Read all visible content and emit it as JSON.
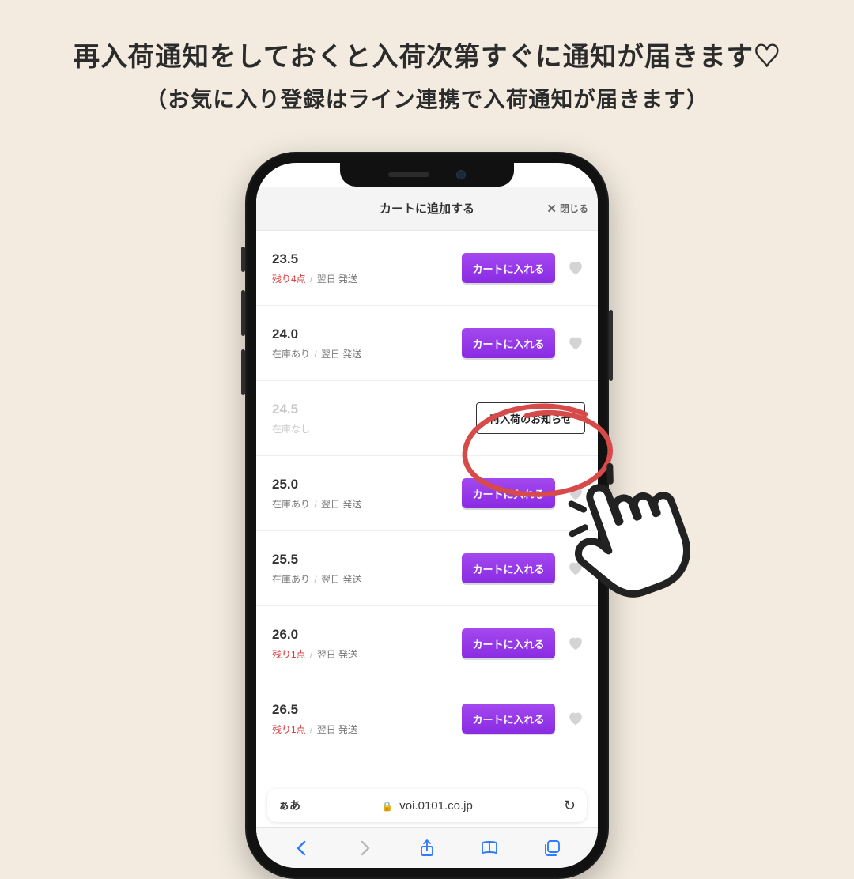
{
  "heading": {
    "line1": "再入荷通知をしておくと入荷次第すぐに通知が届きます♡",
    "line2": "（お気に入り登録はライン連携で入荷通知が届きます）"
  },
  "sheet": {
    "title": "カートに追加する",
    "close_x": "✕",
    "close_label": "閉じる"
  },
  "buttons": {
    "cart": "カートに入れる",
    "restock": "再入荷のお知らせ"
  },
  "stock_texts": {
    "in_stock": "在庫あり",
    "out": "在庫なし",
    "low4": "残り4点",
    "low1": "残り1点",
    "sep": "/",
    "ship": "翌日 発送"
  },
  "items": [
    {
      "size": "23.5",
      "stock_key": "low4",
      "action": "cart",
      "heart": true
    },
    {
      "size": "24.0",
      "stock_key": "in_stock",
      "action": "cart",
      "heart": true
    },
    {
      "size": "24.5",
      "stock_key": "out",
      "action": "restock",
      "heart": false
    },
    {
      "size": "25.0",
      "stock_key": "in_stock",
      "action": "cart",
      "heart": true
    },
    {
      "size": "25.5",
      "stock_key": "in_stock",
      "action": "cart",
      "heart": true
    },
    {
      "size": "26.0",
      "stock_key": "low1",
      "action": "cart",
      "heart": true
    },
    {
      "size": "26.5",
      "stock_key": "low1",
      "action": "cart",
      "heart": true
    }
  ],
  "safari": {
    "aa": "ぁあ",
    "url": "voi.0101.co.jp",
    "reload": "↻"
  }
}
